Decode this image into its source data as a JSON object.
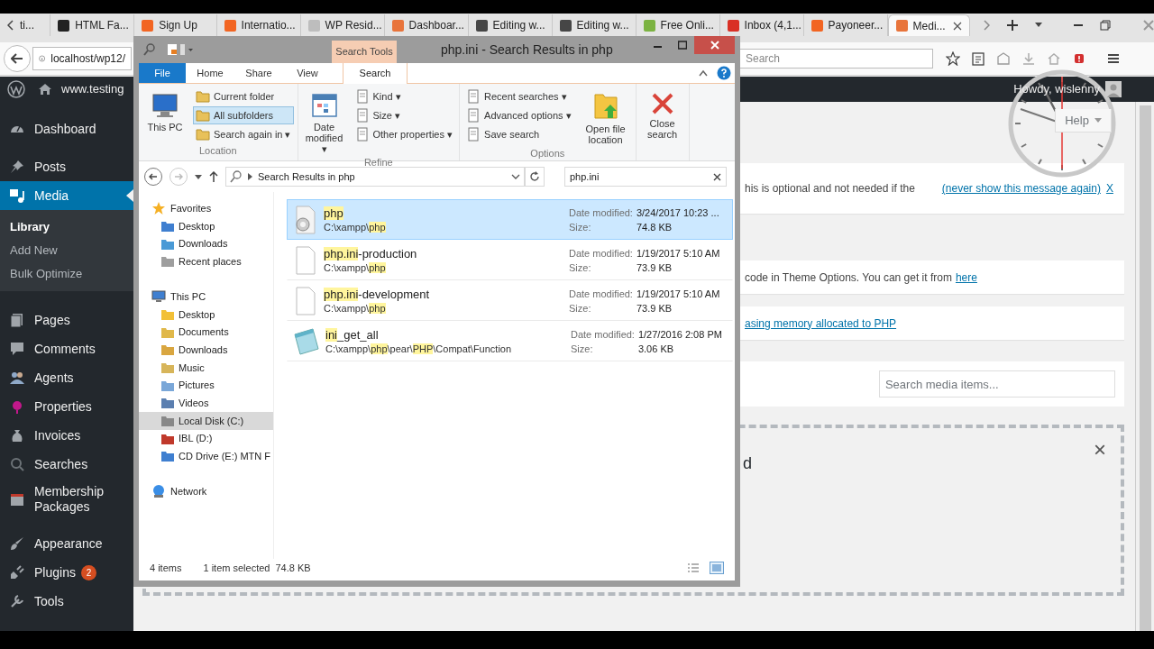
{
  "browser": {
    "tabs": [
      {
        "label": "ti...",
        "selected": false
      },
      {
        "label": "HTML Fa...",
        "color": "#222222",
        "selected": false
      },
      {
        "label": "Sign Up",
        "color": "#f26522",
        "selected": false
      },
      {
        "label": "Internatio...",
        "color": "#f26522",
        "selected": false
      },
      {
        "label": "WP Resid...",
        "color": "#bdbdbd",
        "selected": false
      },
      {
        "label": "Dashboar...",
        "color": "#e8743b",
        "selected": false
      },
      {
        "label": "Editing w...",
        "color": "#464646",
        "selected": false
      },
      {
        "label": "Editing w...",
        "color": "#464646",
        "selected": false
      },
      {
        "label": "Free Onli...",
        "color": "#7cb342",
        "selected": false
      },
      {
        "label": "Inbox (4,1...",
        "color": "#d93025",
        "selected": false
      },
      {
        "label": "Payoneer...",
        "color": "#f26522",
        "selected": false
      },
      {
        "label": "Medi...",
        "color": "#e8743b",
        "selected": true
      }
    ],
    "url": "localhost/wp12/",
    "search_placeholder": "Search"
  },
  "wp": {
    "site": "www.testing",
    "howdy": "Howdy, wislenny",
    "help": "Help",
    "menu": [
      {
        "label": "Dashboard",
        "selected": false
      },
      {
        "label": "Posts",
        "selected": false
      },
      {
        "label": "Media",
        "selected": true,
        "children": [
          {
            "label": "Library",
            "selected": true
          },
          {
            "label": "Add New",
            "selected": false
          },
          {
            "label": "Bulk Optimize",
            "selected": false
          }
        ]
      },
      {
        "label": "Pages",
        "selected": false
      },
      {
        "label": "Comments",
        "selected": false
      },
      {
        "label": "Agents",
        "selected": false
      },
      {
        "label": "Properties",
        "selected": false
      },
      {
        "label": "Invoices",
        "selected": false
      },
      {
        "label": "Searches",
        "selected": false
      },
      {
        "label": "Membership Packages",
        "selected": false
      },
      {
        "label": "Appearance",
        "selected": false
      },
      {
        "label": "Plugins",
        "selected": false,
        "badge": "2"
      },
      {
        "label": "Tools",
        "selected": false
      }
    ],
    "notices": [
      {
        "text": "his is optional and not needed if the",
        "link": "(never show this message again)",
        "dismiss": "X"
      },
      {
        "text": "code in Theme Options. You can get it from",
        "link": "here"
      },
      {
        "link": "asing memory allocated to PHP"
      }
    ],
    "search_placeholder": "Search media items...",
    "upload": {
      "close": "×",
      "text": "d"
    }
  },
  "explorer": {
    "title": "php.ini - Search Results in php",
    "context_tab": "Search Tools",
    "ribbon_tabs": [
      {
        "label": "File",
        "selected": false
      },
      {
        "label": "Home",
        "selected": false
      },
      {
        "label": "Share",
        "selected": false
      },
      {
        "label": "View",
        "selected": false
      },
      {
        "label": "Search",
        "selected": true
      }
    ],
    "groups": [
      {
        "label": "Location",
        "items": [
          {
            "label": "This PC",
            "kind": "large",
            "selected": false
          },
          {
            "label": "Current folder",
            "kind": "small",
            "selected": false
          },
          {
            "label": "All subfolders",
            "kind": "small",
            "selected": true
          },
          {
            "label": "Search again in ▾",
            "kind": "small",
            "selected": false
          }
        ]
      },
      {
        "label": "Refine",
        "items": [
          {
            "label": "Date modified ▾",
            "kind": "large",
            "selected": false
          },
          {
            "label": "Kind ▾",
            "kind": "small",
            "selected": false
          },
          {
            "label": "Size ▾",
            "kind": "small",
            "selected": false
          },
          {
            "label": "Other properties ▾",
            "kind": "small",
            "selected": false
          }
        ]
      },
      {
        "label": "Options",
        "items": [
          {
            "label": "Recent searches ▾",
            "kind": "small",
            "selected": false
          },
          {
            "label": "Advanced options ▾",
            "kind": "small",
            "selected": false
          },
          {
            "label": "Save search",
            "kind": "small",
            "selected": false
          },
          {
            "label": "Open file location",
            "kind": "large",
            "selected": false
          }
        ]
      },
      {
        "items": [
          {
            "label": "Close search",
            "kind": "large",
            "selected": false
          }
        ]
      }
    ],
    "address": "Search Results in php",
    "search_value": "php.ini",
    "nav": [
      {
        "label": "Favorites",
        "selected": false,
        "children": [
          {
            "label": "Desktop",
            "selected": false
          },
          {
            "label": "Downloads",
            "selected": false
          },
          {
            "label": "Recent places",
            "selected": false
          }
        ]
      },
      {
        "label": "This PC",
        "selected": false,
        "children": [
          {
            "label": "Desktop",
            "selected": false
          },
          {
            "label": "Documents",
            "selected": false
          },
          {
            "label": "Downloads",
            "selected": false
          },
          {
            "label": "Music",
            "selected": false
          },
          {
            "label": "Pictures",
            "selected": false
          },
          {
            "label": "Videos",
            "selected": false
          },
          {
            "label": "Local Disk (C:)",
            "selected": true
          },
          {
            "label": "IBL (D:)",
            "selected": false
          },
          {
            "label": "CD Drive (E:) MTN F",
            "selected": false
          }
        ]
      },
      {
        "label": "Network",
        "selected": false
      }
    ],
    "results": [
      {
        "kind": "settings",
        "selected": true,
        "name": [
          {
            "text": "php",
            "match": true
          }
        ],
        "path": [
          {
            "text": "C:\\xampp\\",
            "match": false
          },
          {
            "text": "php",
            "match": true
          }
        ],
        "date_label": "Date modified:",
        "date": "3/24/2017 10:23 ...",
        "size_label": "Size:",
        "size": "74.8 KB"
      },
      {
        "kind": "blank",
        "selected": false,
        "name": [
          {
            "text": "php.ini",
            "match": true
          },
          {
            "text": "-production",
            "match": false
          }
        ],
        "path": [
          {
            "text": "C:\\xampp\\",
            "match": false
          },
          {
            "text": "php",
            "match": true
          }
        ],
        "date_label": "Date modified:",
        "date": "1/19/2017 5:10 AM",
        "size_label": "Size:",
        "size": "73.9 KB"
      },
      {
        "kind": "blank",
        "selected": false,
        "name": [
          {
            "text": "php.ini",
            "match": true
          },
          {
            "text": "-development",
            "match": false
          }
        ],
        "path": [
          {
            "text": "C:\\xampp\\",
            "match": false
          },
          {
            "text": "php",
            "match": true
          }
        ],
        "date_label": "Date modified:",
        "date": "1/19/2017 5:10 AM",
        "size_label": "Size:",
        "size": "73.9 KB"
      },
      {
        "kind": "notepad",
        "selected": false,
        "name": [
          {
            "text": "ini",
            "match": true
          },
          {
            "text": "_get_all",
            "match": false
          }
        ],
        "path": [
          {
            "text": "C:\\xampp\\",
            "match": false
          },
          {
            "text": "php",
            "match": true
          },
          {
            "text": "\\pear\\",
            "match": false
          },
          {
            "text": "PHP",
            "match": true
          },
          {
            "text": "\\Compat\\Function",
            "match": false
          }
        ],
        "date_label": "Date modified:",
        "date": "1/27/2016 2:08 PM",
        "size_label": "Size:",
        "size": "3.06 KB"
      }
    ],
    "status": {
      "count": "4 items",
      "selection": "1 item selected",
      "size": "74.8 KB"
    }
  }
}
